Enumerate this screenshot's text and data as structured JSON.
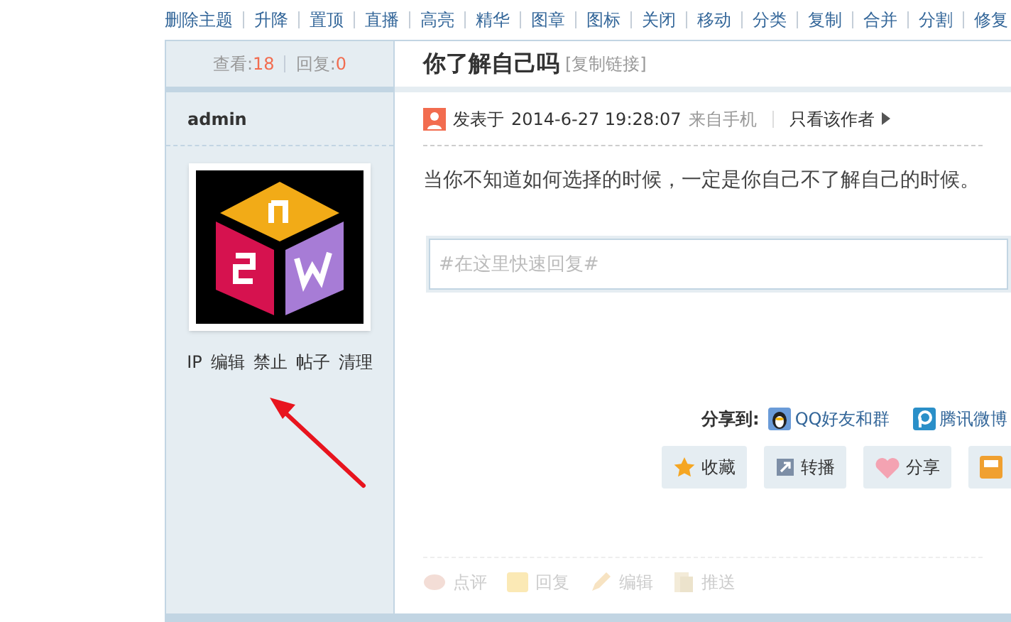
{
  "toolbar": [
    "删除主题",
    "升降",
    "置顶",
    "直播",
    "高亮",
    "精华",
    "图章",
    "图标",
    "关闭",
    "移动",
    "分类",
    "复制",
    "合并",
    "分割",
    "修复"
  ],
  "stats": {
    "views_label": "查看:",
    "views": "18",
    "replies_label": "回复:",
    "replies": "0"
  },
  "thread": {
    "title": "你了解自己吗",
    "copy_link": "[复制链接]"
  },
  "author": {
    "name": "admin",
    "admin_links": [
      "IP",
      "编辑",
      "禁止",
      "帖子",
      "清理"
    ]
  },
  "post": {
    "posted_label": "发表于",
    "datetime": "2014-6-27 19:28:07",
    "source": "来自手机",
    "author_only": "只看该作者",
    "content": "当你不知道如何选择的时候，一定是你自己不了解自己的时候。"
  },
  "quick_reply": {
    "placeholder": "#在这里快速回复#"
  },
  "share": {
    "label": "分享到:",
    "targets": [
      {
        "kind": "qq",
        "label": "QQ好友和群"
      },
      {
        "kind": "weibo",
        "label": "腾讯微博"
      }
    ]
  },
  "actions": [
    {
      "kind": "favorite",
      "label": "收藏"
    },
    {
      "kind": "repost",
      "label": "转播"
    },
    {
      "kind": "share",
      "label": "分享"
    },
    {
      "kind": "tray"
    }
  ],
  "footer_actions": [
    {
      "kind": "comment",
      "label": "点评"
    },
    {
      "kind": "reply",
      "label": "回复"
    },
    {
      "kind": "edit",
      "label": "编辑"
    },
    {
      "kind": "push",
      "label": "推送"
    }
  ]
}
